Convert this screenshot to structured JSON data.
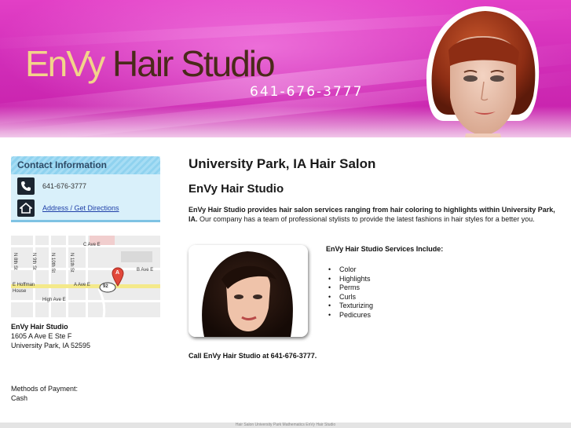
{
  "header": {
    "brand_first": "EnVy",
    "brand_rest": " Hair Studio",
    "phone": "641-676-3777"
  },
  "sidebar": {
    "contact_heading": "Contact Information",
    "phone": "641-676-3777",
    "directions_link": "Address / Get Directions",
    "map_labels": {
      "c_ave": "C Ave E",
      "b_ave": "B Ave E",
      "a_ave": "A Ave E",
      "high_ave": "High Ave E",
      "hoffman": "E Hoffman",
      "house": "House",
      "n8th": "N 8th St",
      "n9th": "N 9th St",
      "n10th": "N 10th St",
      "n11th": "N 11th St",
      "route": "92",
      "pin": "A"
    },
    "business_name": "EnVy Hair Studio",
    "address_line1": "1605 A Ave E Ste F",
    "address_line2": "University Park, IA 52595",
    "payment_label": "Methods of Payment:",
    "payment_value": "Cash"
  },
  "main": {
    "title": "University Park, IA Hair Salon",
    "subtitle": "EnVy Hair Studio",
    "intro_bold": "EnVy Hair Studio provides hair salon services ranging from hair coloring to highlights within University Park, IA.",
    "intro_rest": " Our company has a team of professional stylists to provide the latest fashions in hair styles for a better you.",
    "services_heading": "EnVy Hair Studio Services Include:",
    "services": [
      "Color",
      "Highlights",
      "Perms",
      "Curls",
      "Texturizing",
      "Pedicures"
    ],
    "call_text": "Call EnVy Hair Studio at 641-676-3777."
  },
  "footer": {
    "text": "Hair Salon University Park Mathematics EnVy Hair Studio"
  },
  "colors": {
    "banner_magenta": "#d12db8",
    "brand_gold": "#f3d38a",
    "brand_brown": "#4a2a1a",
    "contact_bg": "#d9f0fa",
    "link_blue": "#1e3fa8"
  },
  "icons": [
    "phone-icon",
    "home-icon",
    "map-pin-icon"
  ]
}
